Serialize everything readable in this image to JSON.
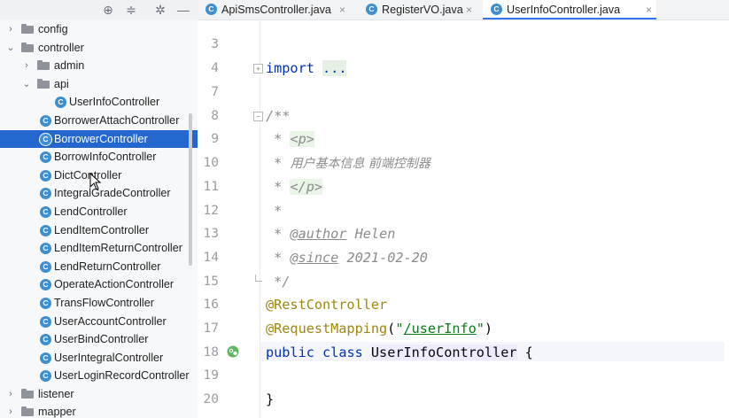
{
  "tree": {
    "rows": [
      {
        "label": "config",
        "type": "folder",
        "depth": 0,
        "arrow": "›"
      },
      {
        "label": "controller",
        "type": "folder",
        "depth": 0,
        "arrow": "⌄"
      },
      {
        "label": "admin",
        "type": "folder",
        "depth": 1,
        "arrow": "›"
      },
      {
        "label": "api",
        "type": "folder",
        "depth": 1,
        "arrow": "⌄"
      },
      {
        "label": "UserInfoController",
        "type": "class",
        "depth": 2
      },
      {
        "label": "BorrowerAttachController",
        "type": "class",
        "depth": 1
      },
      {
        "label": "BorrowerController",
        "type": "class",
        "depth": 1,
        "selected": true
      },
      {
        "label": "BorrowInfoController",
        "type": "class",
        "depth": 1
      },
      {
        "label": "DictController",
        "type": "class",
        "depth": 1
      },
      {
        "label": "IntegralGradeController",
        "type": "class",
        "depth": 1
      },
      {
        "label": "LendController",
        "type": "class",
        "depth": 1
      },
      {
        "label": "LendItemController",
        "type": "class",
        "depth": 1
      },
      {
        "label": "LendItemReturnController",
        "type": "class",
        "depth": 1
      },
      {
        "label": "LendReturnController",
        "type": "class",
        "depth": 1
      },
      {
        "label": "OperateActionController",
        "type": "class",
        "depth": 1
      },
      {
        "label": "TransFlowController",
        "type": "class",
        "depth": 1
      },
      {
        "label": "UserAccountController",
        "type": "class",
        "depth": 1
      },
      {
        "label": "UserBindController",
        "type": "class",
        "depth": 1
      },
      {
        "label": "UserIntegralController",
        "type": "class",
        "depth": 1
      },
      {
        "label": "UserLoginRecordController",
        "type": "class",
        "depth": 1
      },
      {
        "label": "listener",
        "type": "folder",
        "depth": 0,
        "arrow": "›"
      },
      {
        "label": "mapper",
        "type": "folder",
        "depth": 0,
        "arrow": "›"
      }
    ],
    "class_icon_glyph": "C"
  },
  "toolbar": {
    "icons": [
      "target-icon",
      "collapse-icon",
      "gear-icon",
      "minimize-icon"
    ],
    "glyphs": [
      "⊕",
      "≑",
      "✲",
      "—"
    ]
  },
  "tabs": [
    {
      "label": "ApiSmsController.java",
      "active": false,
      "close": "×"
    },
    {
      "label": "RegisterVO.java",
      "active": false,
      "close": "×"
    },
    {
      "label": "UserInfoController.java",
      "active": true,
      "close": "×"
    }
  ],
  "editor": {
    "line_numbers": [
      "3",
      "4",
      "7",
      "8",
      "9",
      "10",
      "11",
      "12",
      "13",
      "14",
      "15",
      "16",
      "17",
      "18",
      "19",
      "20"
    ],
    "line3": "",
    "import_kw": "import",
    "import_fold": "...",
    "doc_open": "/**",
    "star": "*",
    "p_open": "<p>",
    "desc": "用户基本信息 前端控制器",
    "p_close": "</p>",
    "author_tag": "@author",
    "author_val": "Helen",
    "since_tag": "@since",
    "since_val": "2021-02-20",
    "doc_close": "*/",
    "ann_rest": "@RestController",
    "ann_req": "@RequestMapping",
    "paren_open": "(",
    "quote": "\"",
    "mapping_path": "/userInfo",
    "paren_close": ")",
    "kw_public": "public",
    "kw_class": "class",
    "class_name": "UserInfoController",
    "brace_open": "{",
    "brace_close": "}"
  },
  "colors": {
    "selection": "#2468cf",
    "keyword": "#0033b3",
    "annotation": "#9e880d",
    "string": "#067d17",
    "comment": "#8c8c8c"
  }
}
